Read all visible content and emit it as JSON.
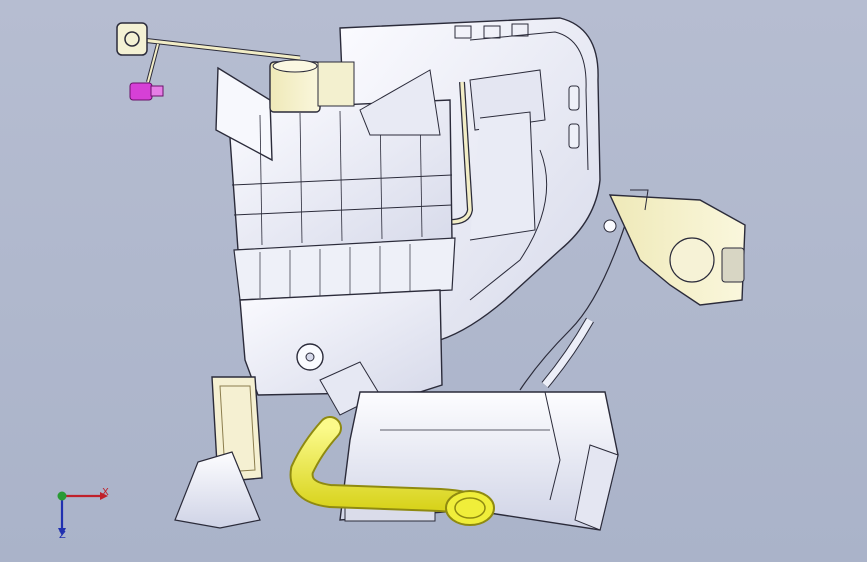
{
  "viewport": {
    "background_top": "#b6bdd1",
    "background_bottom": "#aab3c9",
    "model": "hvac-unit-assembly"
  },
  "triad": {
    "x_label": "X",
    "z_label": "Z",
    "x_color": "#c0202a",
    "y_color": "#2a9a34",
    "z_color": "#2030b0"
  },
  "colors": {
    "housing": "#f4f5fb",
    "housing_shadow": "#d9dcec",
    "outline": "#2b2b3a",
    "duct_yellow": "#f0ee3a",
    "duct_yellow_edge": "#8f8a10",
    "actuator_tan": "#f2edc6",
    "connector_magenta": "#d640d6"
  }
}
